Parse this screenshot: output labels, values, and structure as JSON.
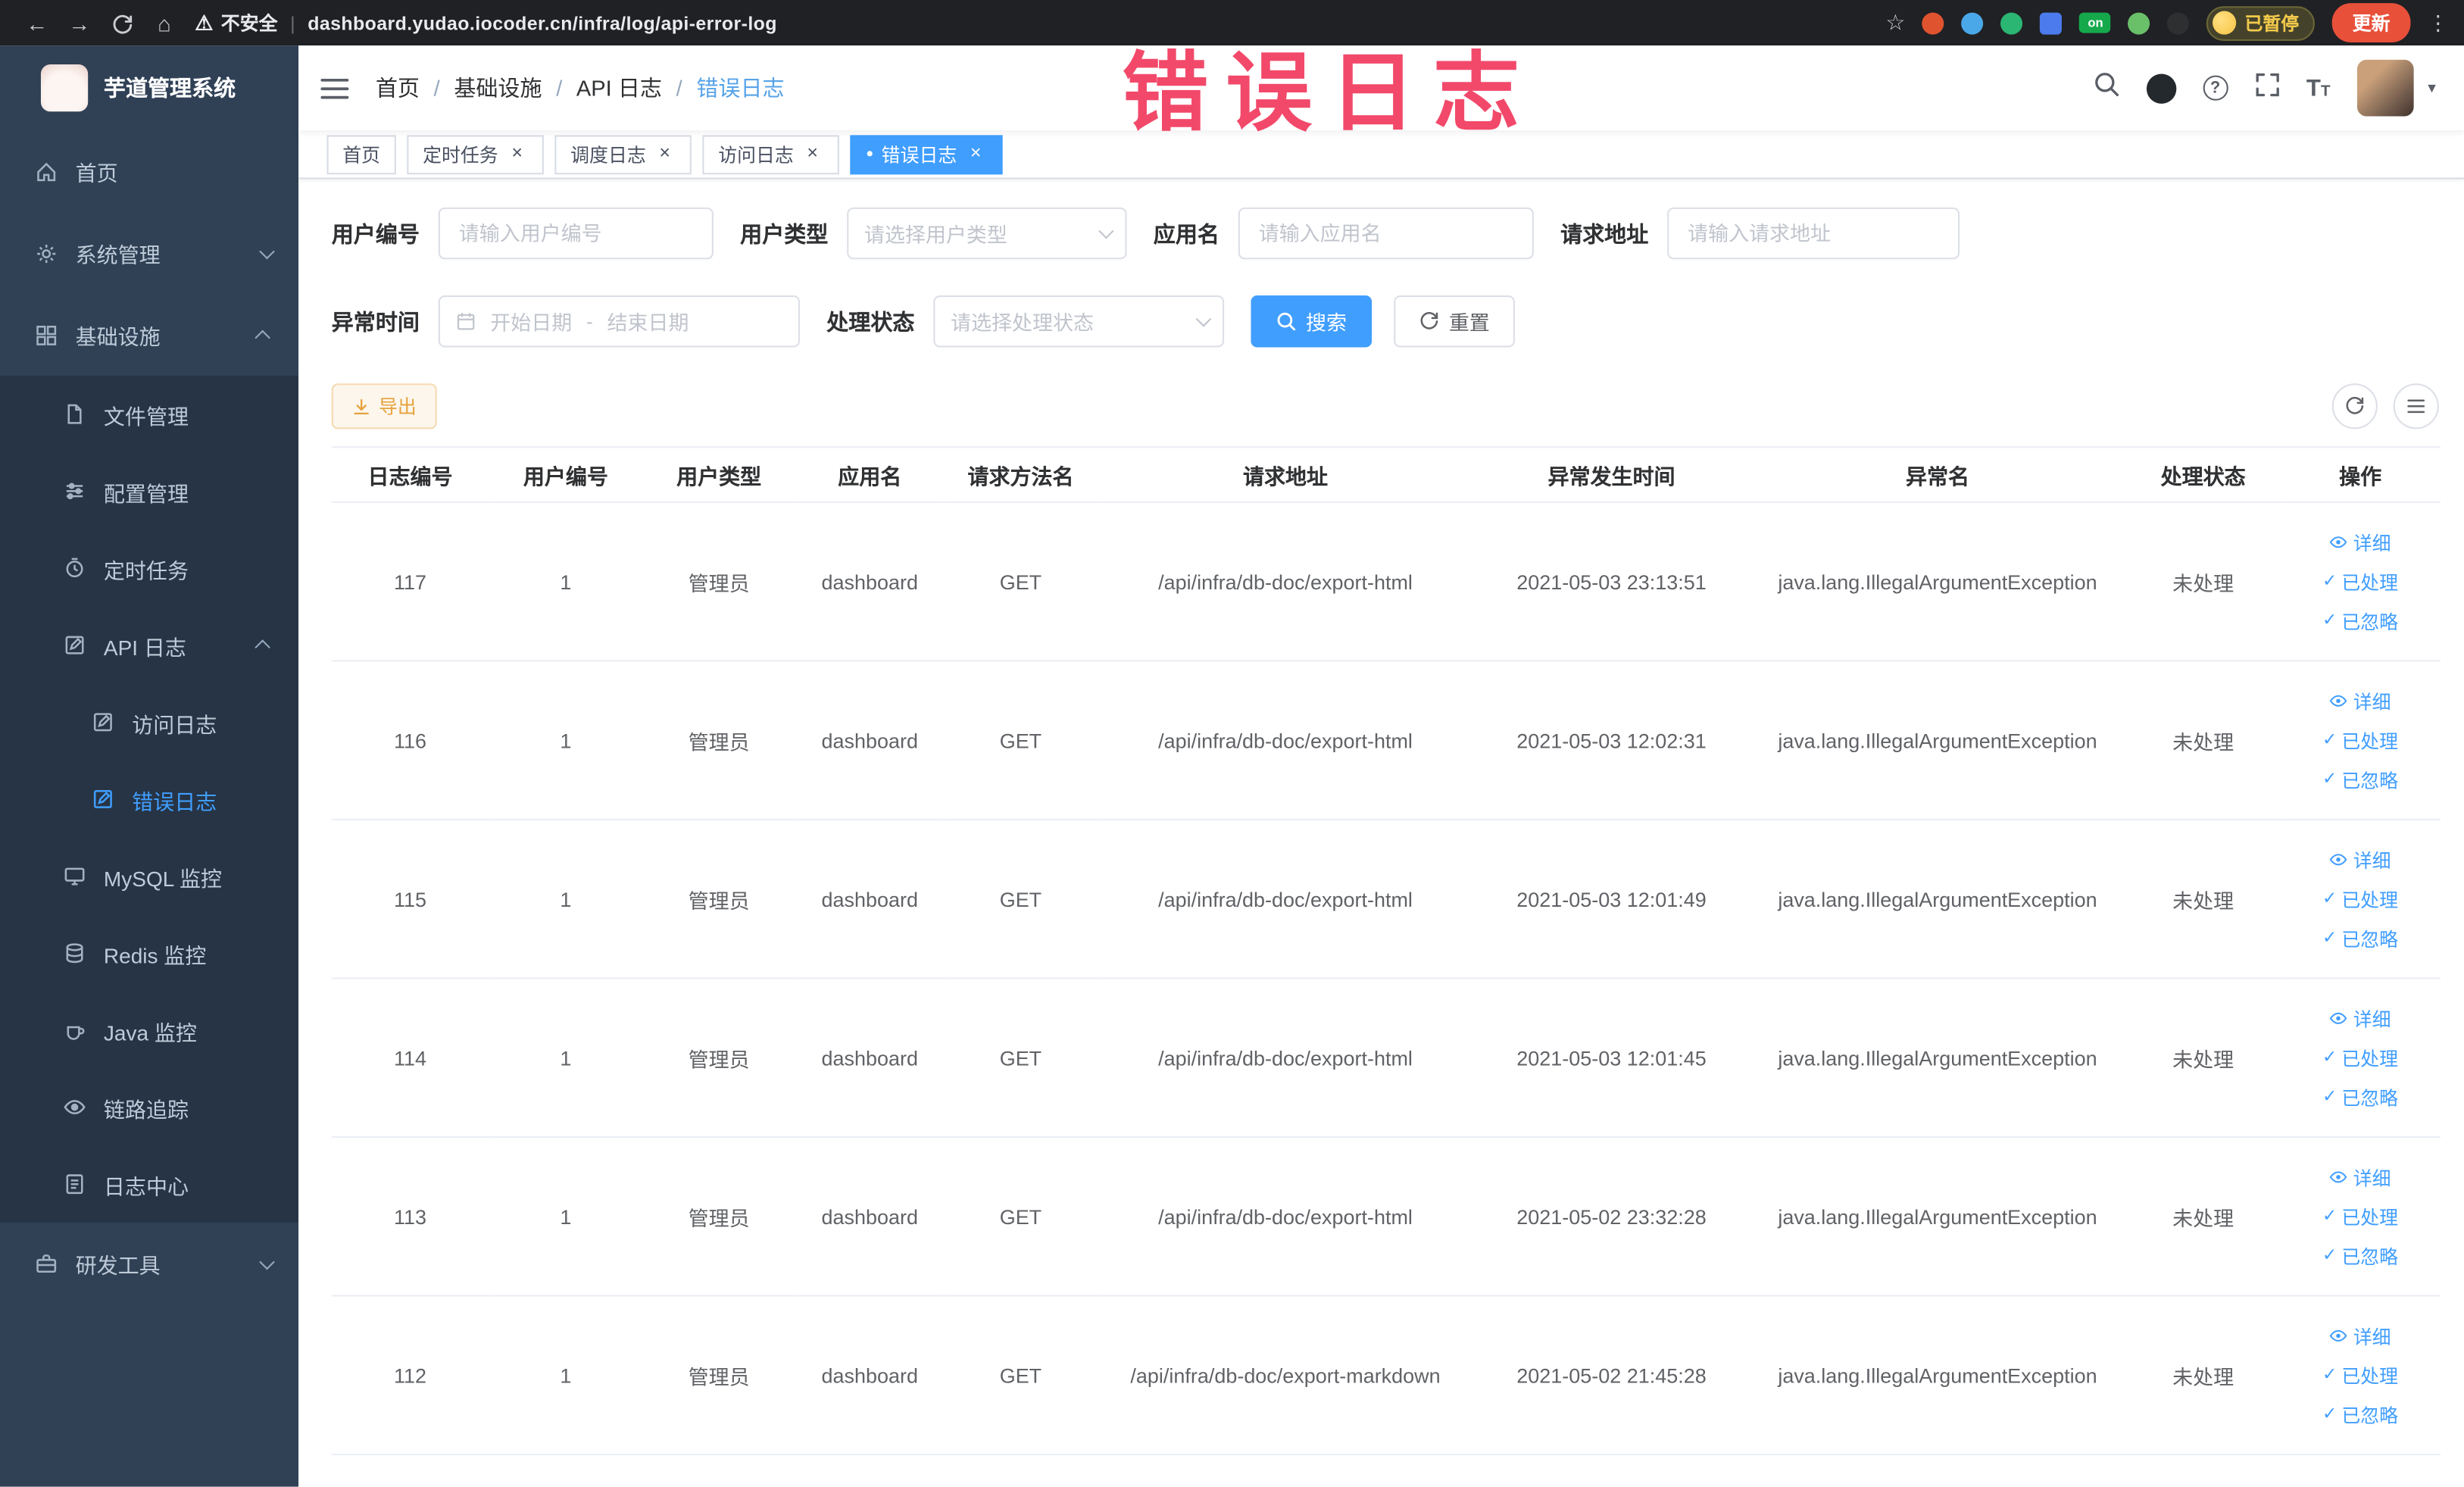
{
  "browser": {
    "security_label": "不安全",
    "url": "dashboard.yudao.iocoder.cn/infra/log/api-error-log",
    "on_badge": "on",
    "paused_label": "已暂停",
    "update_label": "更新"
  },
  "glyphs": {
    "back": "←",
    "forward": "→",
    "home": "⌂",
    "warning": "⚠",
    "pipe": "|",
    "star": "☆",
    "more": "⋮",
    "check": "✓",
    "close": "×",
    "slash": "/",
    "range_sep": "-",
    "dot": "●",
    "question": "?",
    "font_big": "T",
    "font_small": "T",
    "caret": "▾"
  },
  "annotation": {
    "text": "错误日志"
  },
  "sidebar": {
    "logo_title": "芋道管理系统",
    "items": [
      {
        "label": "首页"
      },
      {
        "label": "系统管理"
      },
      {
        "label": "基础设施"
      },
      {
        "label": "文件管理"
      },
      {
        "label": "配置管理"
      },
      {
        "label": "定时任务"
      },
      {
        "label": "API 日志"
      },
      {
        "label": "访问日志"
      },
      {
        "label": "错误日志"
      },
      {
        "label": "MySQL 监控"
      },
      {
        "label": "Redis 监控"
      },
      {
        "label": "Java 监控"
      },
      {
        "label": "链路追踪"
      },
      {
        "label": "日志中心"
      },
      {
        "label": "研发工具"
      }
    ]
  },
  "breadcrumb": {
    "items": [
      "首页",
      "基础设施",
      "API 日志",
      "错误日志"
    ]
  },
  "tabs": [
    {
      "label": "首页"
    },
    {
      "label": "定时任务"
    },
    {
      "label": "调度日志"
    },
    {
      "label": "访问日志"
    },
    {
      "label": "错误日志"
    }
  ],
  "filters": {
    "user_id_label": "用户编号",
    "user_id_placeholder": "请输入用户编号",
    "user_type_label": "用户类型",
    "user_type_placeholder": "请选择用户类型",
    "app_name_label": "应用名",
    "app_name_placeholder": "请输入应用名",
    "request_url_label": "请求地址",
    "request_url_placeholder": "请输入请求地址",
    "exception_time_label": "异常时间",
    "start_placeholder": "开始日期",
    "end_placeholder": "结束日期",
    "status_label": "处理状态",
    "status_placeholder": "请选择处理状态",
    "search_label": "搜索",
    "reset_label": "重置"
  },
  "toolbar": {
    "export_label": "导出"
  },
  "table": {
    "columns": [
      "日志编号",
      "用户编号",
      "用户类型",
      "应用名",
      "请求方法名",
      "请求地址",
      "异常发生时间",
      "异常名",
      "处理状态",
      "操作"
    ],
    "actions": [
      "详细",
      "已处理",
      "已忽略"
    ],
    "rows": [
      {
        "log_id": "117",
        "user_id": "1",
        "user_type": "管理员",
        "app_name": "dashboard",
        "method": "GET",
        "request_url": "/api/infra/db-doc/export-html",
        "exception_time": "2021-05-03 23:13:51",
        "exception_name": "java.lang.IllegalArgumentException",
        "status": "未处理"
      },
      {
        "log_id": "116",
        "user_id": "1",
        "user_type": "管理员",
        "app_name": "dashboard",
        "method": "GET",
        "request_url": "/api/infra/db-doc/export-html",
        "exception_time": "2021-05-03 12:02:31",
        "exception_name": "java.lang.IllegalArgumentException",
        "status": "未处理"
      },
      {
        "log_id": "115",
        "user_id": "1",
        "user_type": "管理员",
        "app_name": "dashboard",
        "method": "GET",
        "request_url": "/api/infra/db-doc/export-html",
        "exception_time": "2021-05-03 12:01:49",
        "exception_name": "java.lang.IllegalArgumentException",
        "status": "未处理"
      },
      {
        "log_id": "114",
        "user_id": "1",
        "user_type": "管理员",
        "app_name": "dashboard",
        "method": "GET",
        "request_url": "/api/infra/db-doc/export-html",
        "exception_time": "2021-05-03 12:01:45",
        "exception_name": "java.lang.IllegalArgumentException",
        "status": "未处理"
      },
      {
        "log_id": "113",
        "user_id": "1",
        "user_type": "管理员",
        "app_name": "dashboard",
        "method": "GET",
        "request_url": "/api/infra/db-doc/export-html",
        "exception_time": "2021-05-02 23:32:28",
        "exception_name": "java.lang.IllegalArgumentException",
        "status": "未处理"
      },
      {
        "log_id": "112",
        "user_id": "1",
        "user_type": "管理员",
        "app_name": "dashboard",
        "method": "GET",
        "request_url": "/api/infra/db-doc/export-markdown",
        "exception_time": "2021-05-02 21:45:28",
        "exception_name": "java.lang.IllegalArgumentException",
        "status": "未处理"
      }
    ]
  },
  "colors": {
    "primary": "#409eff",
    "warning": "#e6a23c",
    "annotation_red": "#f23c5f",
    "sidebar_bg": "#304156",
    "submenu_bg": "#263445"
  }
}
